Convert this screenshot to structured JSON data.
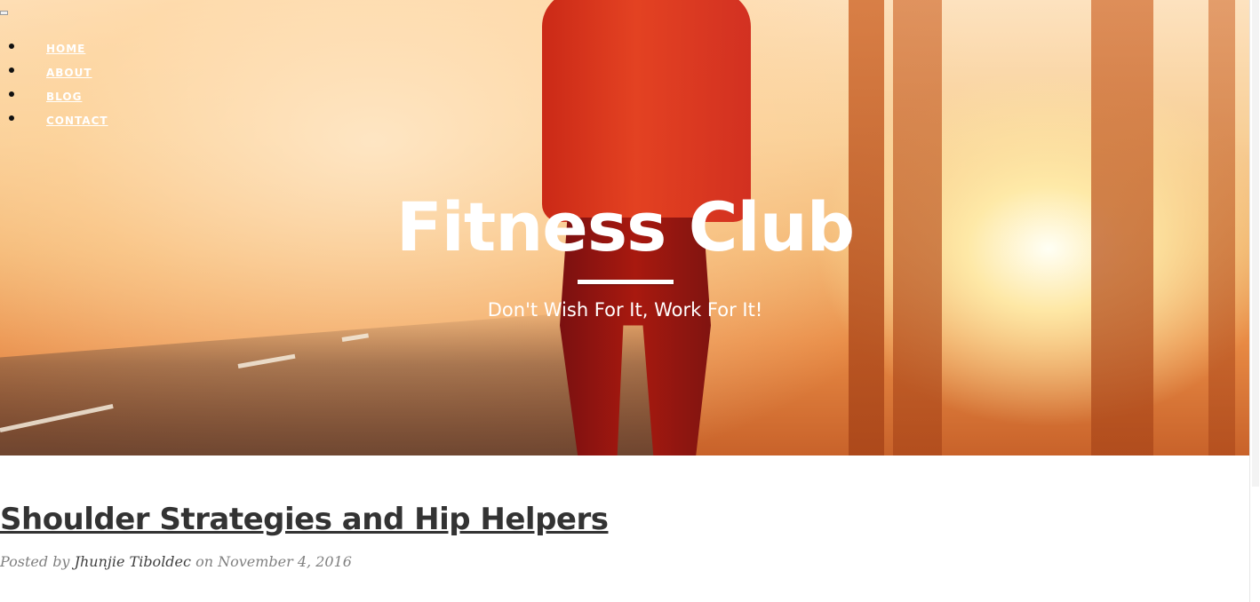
{
  "nav": {
    "items": [
      {
        "label": "HOME"
      },
      {
        "label": "ABOUT"
      },
      {
        "label": "BLOG"
      },
      {
        "label": "CONTACT"
      }
    ]
  },
  "hero": {
    "title": "Fitness Club",
    "tagline": "Don't Wish For It, Work For It!"
  },
  "post": {
    "title": "Shoulder Strategies and Hip Helpers",
    "posted_by_prefix": "Posted by",
    "author": "Jhunjie Tiboldec",
    "date_prefix": "on",
    "date": "November 4, 2016"
  },
  "colors": {
    "hero_warm": "#f0ae67",
    "title_text": "#ffffff",
    "post_title": "#333333",
    "meta_text": "#808080"
  }
}
